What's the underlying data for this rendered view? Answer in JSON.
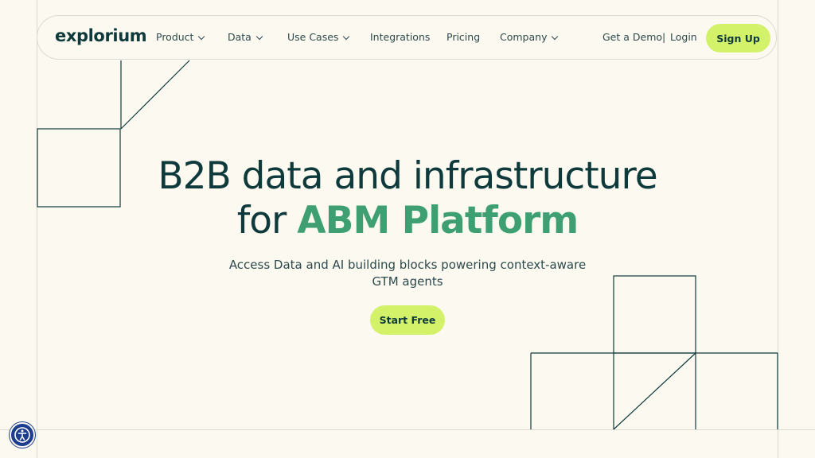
{
  "brand": {
    "logo_text": "explorium"
  },
  "nav": {
    "items": [
      {
        "label": "Product",
        "has_dropdown": true
      },
      {
        "label": "Data",
        "has_dropdown": true
      },
      {
        "label": "Use Cases",
        "has_dropdown": true
      },
      {
        "label": "Integrations",
        "has_dropdown": false
      },
      {
        "label": "Pricing",
        "has_dropdown": false
      },
      {
        "label": "Company",
        "has_dropdown": true
      }
    ],
    "demo_label": "Get a Demo",
    "separator": "|",
    "login_label": "Login",
    "signup_label": "Sign Up"
  },
  "hero": {
    "title_line1": "B2B data and infrastructure",
    "title_line2_prefix": "for ",
    "title_line2_accent": "ABM Platform",
    "subtitle_line1": "Access Data and AI building blocks powering context-aware",
    "subtitle_line2": "GTM agents",
    "cta_label": "Start Free"
  },
  "accessibility_widget": {
    "icon": "accessibility-icon"
  },
  "colors": {
    "background": "#fcf9f1",
    "text": "#0f3a3c",
    "accent_green": "#3d9f72",
    "button_lime": "#d3f26a",
    "lines": "#0f3a3c",
    "a11y_blue": "#1d3d8f"
  }
}
